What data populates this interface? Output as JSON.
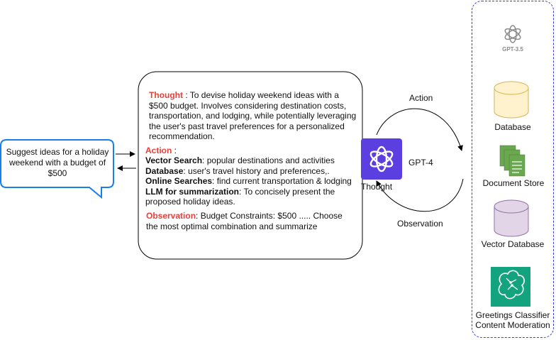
{
  "query_bubble": {
    "text": "Suggest ideas for a holiday weekend with a budget of $500"
  },
  "reasoning_box": {
    "thought_label": "Thought",
    "thought_text": " : To devise holiday weekend ideas with a $500 budget. Involves considering destination costs, transportation, and lodging, while potentially leveraging the user's past travel preferences for a personalized recommendation.",
    "action_label": "Action",
    "action_suffix": " :",
    "actions": [
      {
        "name": "Vector Search",
        "text": ": popular destinations and activities"
      },
      {
        "name": "Database",
        "text": ": user's travel history and preferences,."
      },
      {
        "name": "Online Searches",
        "text": ": find current transportation & lodging"
      },
      {
        "name": "LLM for summarization",
        "text": ": To concisely present the proposed holiday ideas."
      }
    ],
    "observation_label": "Observation",
    "observation_text": ": Budget Constraints: $500 ..... Choose the most optimal combination and summarize"
  },
  "loop": {
    "model_label": "GPT-4",
    "action_label": "Action",
    "thought_label": "Thought",
    "observation_label": "Observation"
  },
  "sidebar": {
    "gpt35_label": "GPT-3.5",
    "database_label": "Database",
    "document_store_label": "Document Store",
    "vector_database_label": "Vector Database",
    "greetings_label": "Greetings Classifier",
    "moderation_label": "Content Moderation"
  },
  "colors": {
    "accent_red": "#e8403a",
    "gpt4_purple": "#5b3fe0",
    "bubble_blue": "#1a7fe8",
    "sidebar_border": "#3a3ad6",
    "database_yellow": "#fff2cc",
    "document_green": "#6aa84f",
    "vector_purple": "#e1d5e7",
    "classifier_teal": "#14a37f"
  },
  "icons": [
    "openai-logo-icon",
    "database-cylinder-icon",
    "document-stack-icon",
    "brain-circuit-icon"
  ]
}
